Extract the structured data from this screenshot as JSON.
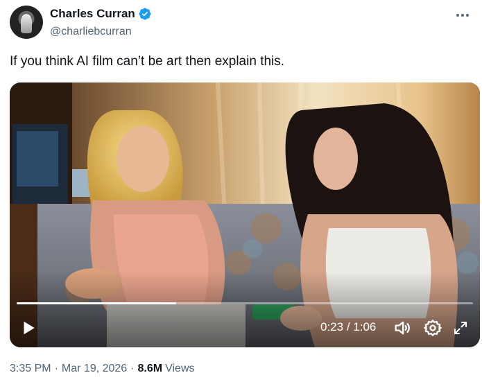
{
  "author": {
    "display_name": "Charles Curran",
    "handle": "@charliebcurran",
    "verified": true,
    "verified_color": "#1d9bf0"
  },
  "tweet": {
    "text": "If you think AI film can’t be art then explain this."
  },
  "video": {
    "current_time": "0:23",
    "separator": " / ",
    "duration": "1:06",
    "progress": 0.35,
    "icons": [
      "play-icon",
      "volume-icon",
      "settings-icon",
      "fullscreen-icon"
    ]
  },
  "meta": {
    "time": "3:35 PM",
    "date": "Mar 19, 2026",
    "views_count": "8.6M",
    "views_label": "Views"
  }
}
